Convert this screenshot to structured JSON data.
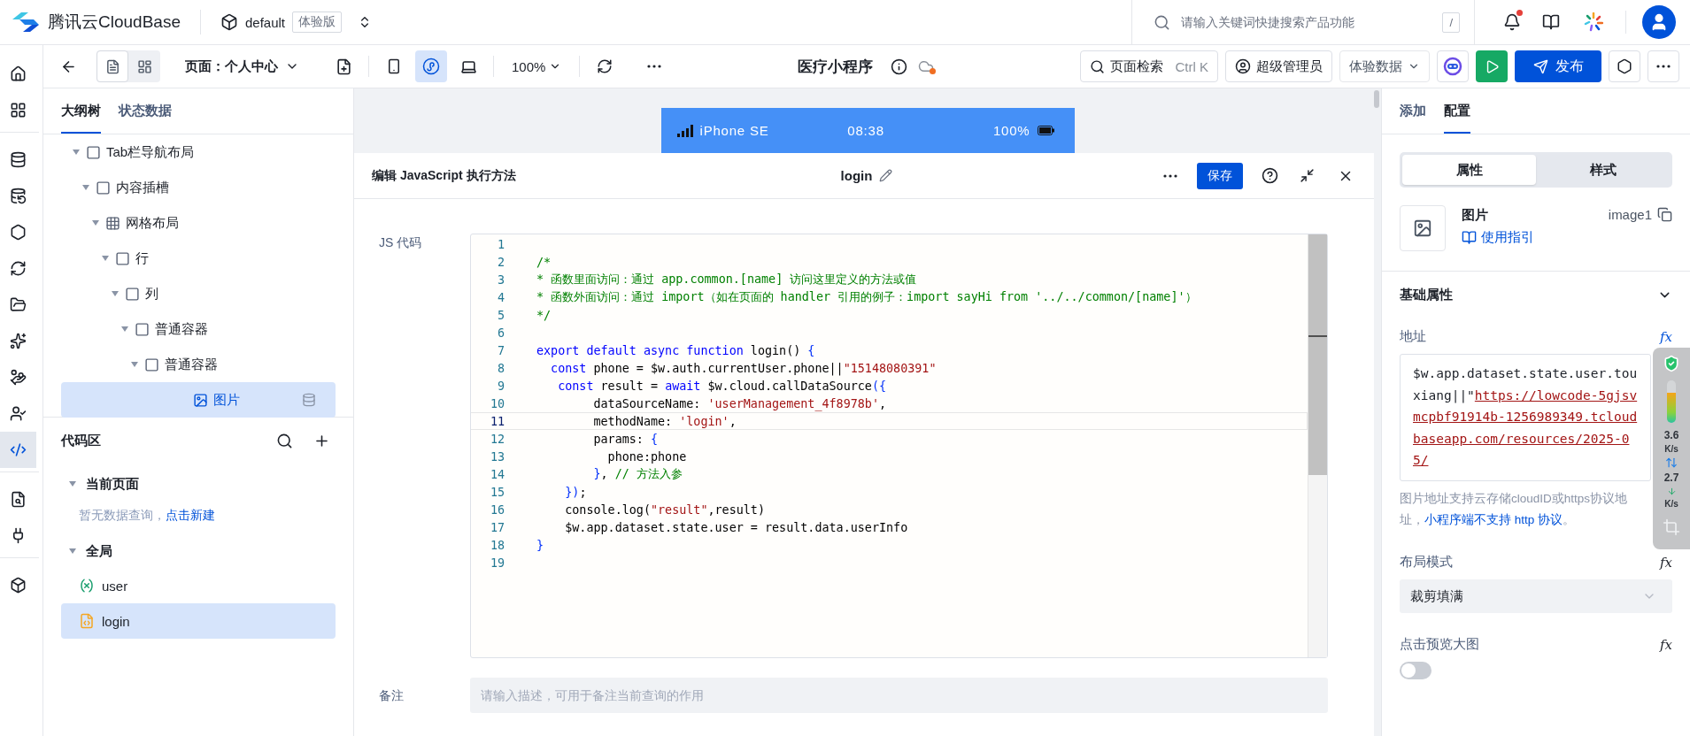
{
  "header": {
    "brand": "腾讯云CloudBase",
    "env": "default",
    "env_badge": "体验版",
    "search": {
      "placeholder": "请输入关键词快捷搜索产品功能",
      "shortcut": "/"
    },
    "notifications": {
      "unread": true
    }
  },
  "rail_groups": [
    [
      {
        "selected": false
      },
      {
        "selected": false
      }
    ],
    [
      {
        "selected": false
      },
      {
        "selected": false
      },
      {
        "selected": false
      },
      {
        "selected": false
      },
      {
        "selected": false
      },
      {
        "selected": false
      },
      {
        "selected": false
      },
      {
        "selected": false
      },
      {
        "selected": true
      }
    ],
    [
      {
        "selected": false
      },
      {
        "selected": false
      }
    ],
    [
      {
        "selected": false
      }
    ]
  ],
  "toolbar": {
    "views": [
      {
        "selected": true
      },
      {
        "selected": false
      }
    ],
    "page_label": "页面：个人中心",
    "devices": [
      {
        "selected": false
      },
      {
        "selected": true
      },
      {
        "selected": false
      }
    ],
    "zoom": "100%",
    "app_title": "医疗小程序",
    "page_search": {
      "label": "页面检索",
      "shortcut": "Ctrl K"
    },
    "role": "超级管理员",
    "data_mode": "体验数据",
    "publish": "发布"
  },
  "tree_panel": {
    "tabs": [
      {
        "label": "大纲树",
        "selected": true
      },
      {
        "label": "状态数据",
        "selected": false
      }
    ],
    "outline": [
      {
        "label": "Tab栏导航布局",
        "kind": "container",
        "expanded": true,
        "selected": false,
        "children": [
          {
            "label": "内容插槽",
            "kind": "container",
            "expanded": true,
            "selected": false,
            "children": [
              {
                "label": "网格布局",
                "kind": "grid",
                "expanded": true,
                "selected": false,
                "children": [
                  {
                    "label": "行",
                    "kind": "container",
                    "expanded": true,
                    "selected": false,
                    "children": [
                      {
                        "label": "列",
                        "kind": "container",
                        "expanded": true,
                        "selected": false,
                        "children": [
                          {
                            "label": "普通容器",
                            "kind": "container",
                            "expanded": true,
                            "selected": false,
                            "children": [
                              {
                                "label": "普通容器",
                                "kind": "container",
                                "expanded": true,
                                "selected": false,
                                "children": [
                                  {
                                    "label": "图片",
                                    "kind": "image",
                                    "selected": true
                                  }
                                ]
                              }
                            ]
                          }
                        ]
                      }
                    ]
                  }
                ]
              }
            ]
          }
        ]
      }
    ]
  },
  "code_area": {
    "title": "代码区",
    "groups": [
      {
        "label": "当前页面",
        "expanded": true,
        "empty_text": "暂无数据查询，",
        "empty_link": "点击新建"
      },
      {
        "label": "全局",
        "expanded": true,
        "items": [
          {
            "label": "user",
            "kind": "variable",
            "selected": false
          },
          {
            "label": "login",
            "kind": "script",
            "selected": true
          }
        ]
      }
    ]
  },
  "phone": {
    "device": "iPhone SE",
    "time": "08:38",
    "battery": "100%"
  },
  "editor": {
    "title": "编辑 JavaScript 执行方法",
    "method_name": "login",
    "save": "保存",
    "code_label": "JS 代码",
    "lines": [
      {
        "number": "1",
        "current": false
      },
      {
        "number": "2",
        "current": false,
        "tokens": [
          {
            "kind": "comment",
            "text": "/*"
          }
        ]
      },
      {
        "number": "3",
        "current": false,
        "tokens": [
          {
            "kind": "comment",
            "text": "* 函数里面访问：通过 app.common.[name] 访问这里定义的方法或值"
          }
        ]
      },
      {
        "number": "4",
        "current": false,
        "tokens": [
          {
            "kind": "comment",
            "text": "* 函数外面访问：通过 import（如在页面的 handler 引用的例子：import sayHi from '../../common/[name]'）"
          }
        ]
      },
      {
        "number": "5",
        "current": false,
        "tokens": [
          {
            "kind": "comment",
            "text": "*/"
          }
        ]
      },
      {
        "number": "6",
        "current": false
      },
      {
        "number": "7",
        "current": false,
        "tokens": [
          {
            "kind": "keyword",
            "text": "export default async function"
          },
          {
            "kind": "plain",
            "text": " login() "
          },
          {
            "kind": "punct",
            "text": "{"
          }
        ]
      },
      {
        "number": "8",
        "current": false,
        "tokens": [
          {
            "kind": "keyword",
            "text": "  const"
          },
          {
            "kind": "plain",
            "text": " phone = $w.auth.currentUser.phone||"
          },
          {
            "kind": "string",
            "text": "\"15148080391\""
          }
        ]
      },
      {
        "number": "9",
        "current": false,
        "tokens": [
          {
            "kind": "keyword",
            "text": "   const"
          },
          {
            "kind": "plain",
            "text": " result = "
          },
          {
            "kind": "keyword",
            "text": "await"
          },
          {
            "kind": "plain",
            "text": " $w.cloud.callDataSource"
          },
          {
            "kind": "punct",
            "text": "({"
          }
        ]
      },
      {
        "number": "10",
        "current": false,
        "tokens": [
          {
            "kind": "plain",
            "text": "        dataSourceName: "
          },
          {
            "kind": "string",
            "text": "'userManagement_4f8978b'"
          },
          {
            "kind": "plain",
            "text": ","
          }
        ]
      },
      {
        "number": "11",
        "current": true,
        "tokens": [
          {
            "kind": "plain",
            "text": "        methodName: "
          },
          {
            "kind": "string",
            "text": "'login'"
          },
          {
            "kind": "plain",
            "text": ","
          }
        ]
      },
      {
        "number": "12",
        "current": false,
        "tokens": [
          {
            "kind": "plain",
            "text": "        params: "
          },
          {
            "kind": "punct",
            "text": "{"
          }
        ]
      },
      {
        "number": "13",
        "current": false,
        "tokens": [
          {
            "kind": "plain",
            "text": "          phone:phone"
          }
        ]
      },
      {
        "number": "14",
        "current": false,
        "tokens": [
          {
            "kind": "punct",
            "text": "        }"
          },
          {
            "kind": "plain",
            "text": ", "
          },
          {
            "kind": "comment",
            "text": "// 方法入参"
          }
        ]
      },
      {
        "number": "15",
        "current": false,
        "tokens": [
          {
            "kind": "punct",
            "text": "    })"
          },
          {
            "kind": "plain",
            "text": ";"
          }
        ]
      },
      {
        "number": "16",
        "current": false,
        "tokens": [
          {
            "kind": "plain",
            "text": "    console.log("
          },
          {
            "kind": "string",
            "text": "\"result\""
          },
          {
            "kind": "plain",
            "text": ",result)"
          }
        ]
      },
      {
        "number": "17",
        "current": false,
        "tokens": [
          {
            "kind": "plain",
            "text": "    $w.app.dataset.state.user = result.data.userInfo"
          }
        ]
      },
      {
        "number": "18",
        "current": false,
        "tokens": [
          {
            "kind": "punct",
            "text": "}"
          }
        ]
      },
      {
        "number": "19",
        "current": false
      }
    ],
    "remark": {
      "label": "备注",
      "placeholder": "请输入描述，可用于备注当前查询的作用"
    }
  },
  "right_panel": {
    "tabs": [
      {
        "label": "添加",
        "selected": false
      },
      {
        "label": "配置",
        "selected": true
      }
    ],
    "segments": [
      {
        "label": "属性",
        "selected": true
      },
      {
        "label": "样式",
        "selected": false
      }
    ],
    "component": {
      "name": "图片",
      "guide": "使用指引",
      "id": "image1"
    },
    "section": {
      "title": "基础属性",
      "expanded": true
    },
    "fields": [
      {
        "kind": "expression",
        "label": "地址",
        "fx": "fx",
        "segments": [
          {
            "kind": "plain",
            "text": "$w.app.dataset.state.user.touxiang||\""
          },
          {
            "kind": "url",
            "text": "https://lowcode-5gjsvmcpbf91914b-1256989349.tcloudbaseapp.com/resources/2025-05/"
          }
        ],
        "hint": "图片地址支持云存储cloudID或https协议地址，",
        "hint_link": "小程序端不支持 http 协议",
        "hint_end": "。"
      },
      {
        "kind": "select",
        "label": "布局模式",
        "fx": "fx",
        "value": "裁剪填满"
      },
      {
        "kind": "toggle",
        "label": "点击预览大图",
        "fx": "fx",
        "on": false
      }
    ]
  },
  "net_monitor": {
    "upload": "3.6",
    "upload_unit": "K/s",
    "download": "2.7",
    "download_unit": "K/s"
  }
}
